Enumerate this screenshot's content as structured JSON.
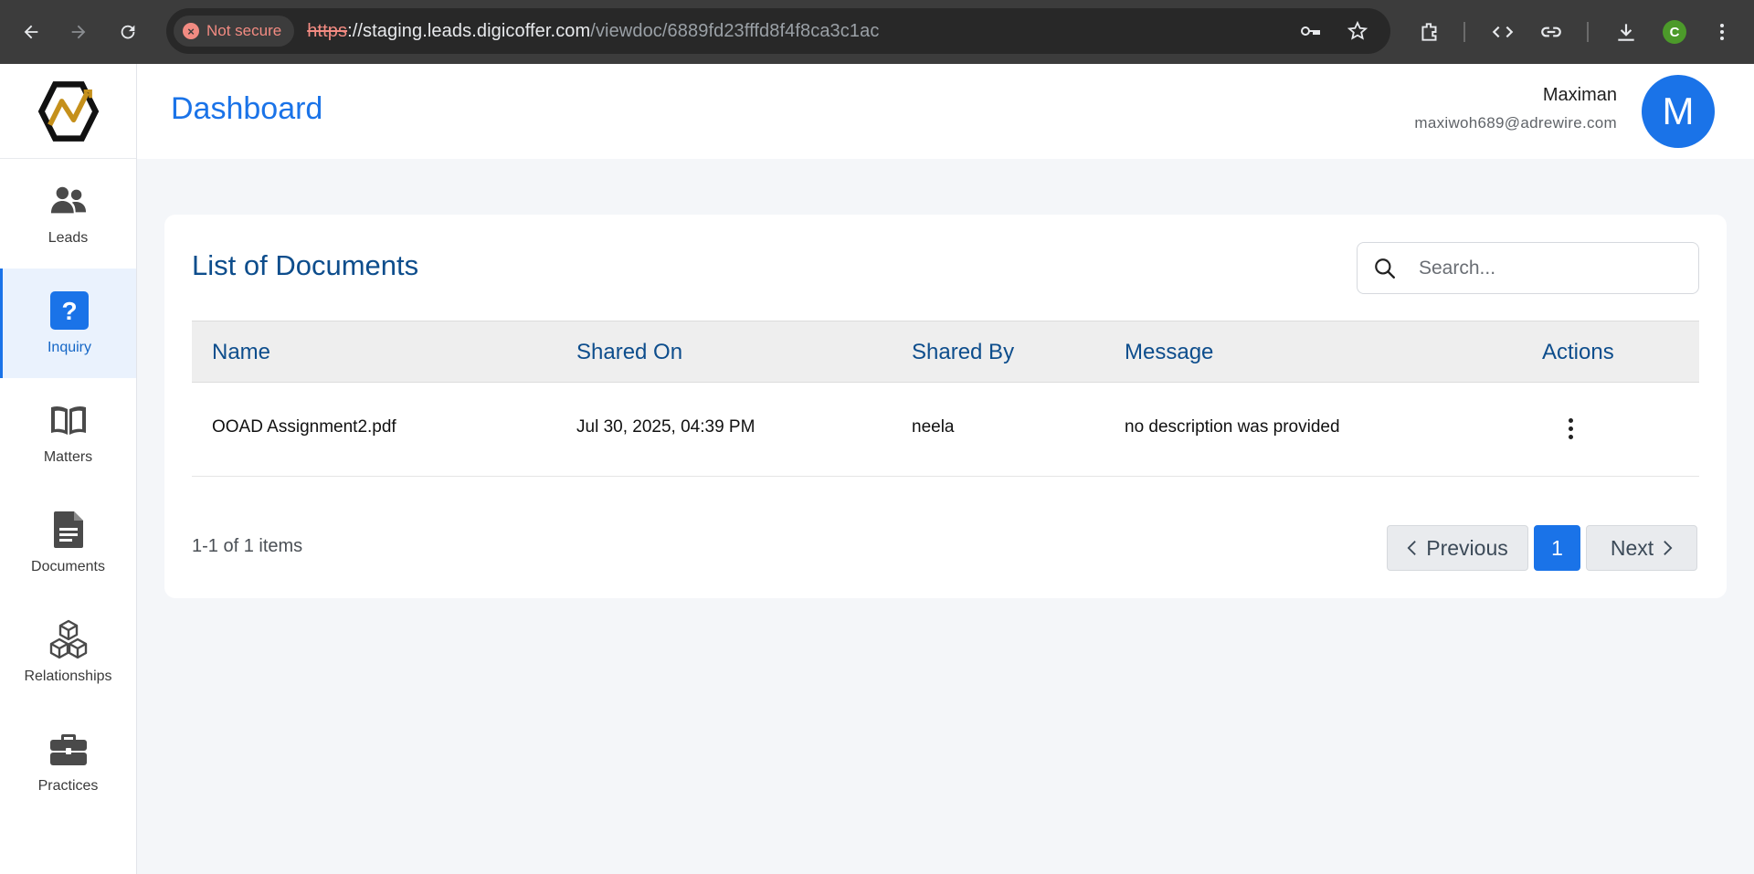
{
  "browser": {
    "security_label": "Not secure",
    "url_scheme": "https",
    "url_host": "://staging.leads.digicoffer.com",
    "url_path": "/viewdoc/6889fd23fffd8f4f8ca3c1ac",
    "profile_initial": "C"
  },
  "sidebar": {
    "items": [
      {
        "label": "Leads",
        "icon": "users-icon"
      },
      {
        "label": "Inquiry",
        "icon": "question-icon",
        "active": true
      },
      {
        "label": "Matters",
        "icon": "book-icon"
      },
      {
        "label": "Documents",
        "icon": "document-icon"
      },
      {
        "label": "Relationships",
        "icon": "cubes-icon"
      },
      {
        "label": "Practices",
        "icon": "briefcase-icon"
      }
    ]
  },
  "header": {
    "title": "Dashboard",
    "user_name": "Maximan",
    "user_email": "maxiwoh689@adrewire.com",
    "avatar_initial": "M"
  },
  "documents": {
    "title": "List of Documents",
    "search_placeholder": "Search...",
    "columns": [
      "Name",
      "Shared On",
      "Shared By",
      "Message",
      "Actions"
    ],
    "rows": [
      {
        "name": "OOAD Assignment2.pdf",
        "shared_on": "Jul 30, 2025, 04:39 PM",
        "shared_by": "neela",
        "message": "no description was provided"
      }
    ],
    "items_count": "1-1 of 1 items",
    "pagination": {
      "previous": "Previous",
      "current_page": "1",
      "next": "Next"
    }
  },
  "colors": {
    "accent": "#1a73e8",
    "heading": "#0d4d8c"
  }
}
